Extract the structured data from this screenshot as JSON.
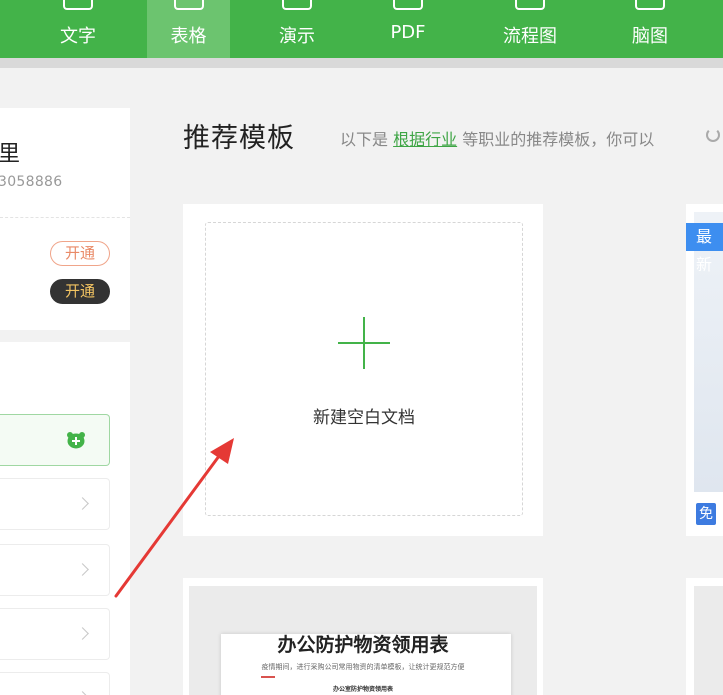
{
  "nav": {
    "tabs": [
      {
        "label": "文字",
        "active": false
      },
      {
        "label": "表格",
        "active": true
      },
      {
        "label": "演示",
        "active": false
      },
      {
        "label": "PDF",
        "active": false
      },
      {
        "label": "流程图",
        "active": false
      },
      {
        "label": "脑图",
        "active": false
      }
    ]
  },
  "user": {
    "name": "里",
    "id": "3058886",
    "open_label": "开通",
    "open_label_vip": "开通"
  },
  "main": {
    "heading": "推荐模板",
    "sub_prefix": "以下是",
    "sub_link": "根据行业",
    "sub_suffix": "等职业的推荐模板，你可以",
    "new_blank_label": "新建空白文档",
    "badge_new": "最新",
    "badge_free": "免",
    "template_title": "办公防护物资领用表",
    "template_desc": "疫情期间，进行采购公司常用物资的清单模板，让统计更规范方便",
    "template_mini_title": "办公室防护物资领用表"
  },
  "colors": {
    "brand_green": "#43b349",
    "active_tab": "#6cc46f",
    "link_green": "#3ea545",
    "arrow_red": "#e53935",
    "badge_blue": "#3d8ef0"
  }
}
